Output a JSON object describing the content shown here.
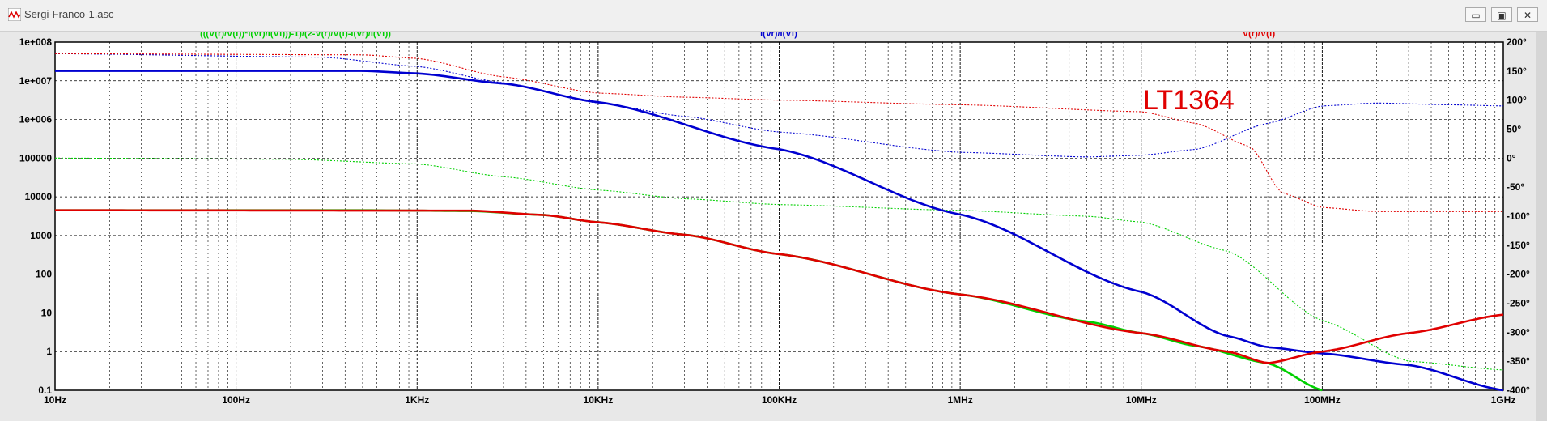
{
  "window": {
    "title": "Sergi-Franco-1.asc",
    "minimize_label": "▭",
    "restore_label": "▣",
    "close_label": "✕"
  },
  "colors": {
    "green": "#00d000",
    "blue": "#0000d0",
    "red": "#e00000",
    "grid": "#000000",
    "background": "#ffffff"
  },
  "chart_data": {
    "type": "line",
    "annotation": "LT1364",
    "x_scale": "log",
    "x_range_hz": [
      10,
      1000000000
    ],
    "x_ticks": [
      {
        "v": 10,
        "label": "10Hz"
      },
      {
        "v": 100,
        "label": "100Hz"
      },
      {
        "v": 1000,
        "label": "1KHz"
      },
      {
        "v": 10000,
        "label": "10KHz"
      },
      {
        "v": 100000,
        "label": "100KHz"
      },
      {
        "v": 1000000,
        "label": "1MHz"
      },
      {
        "v": 10000000,
        "label": "10MHz"
      },
      {
        "v": 100000000,
        "label": "100MHz"
      },
      {
        "v": 1000000000,
        "label": "1GHz"
      }
    ],
    "y_left_scale": "log",
    "y_left_range": [
      0.1,
      100000000
    ],
    "y_left_ticks": [
      {
        "v": 100000000,
        "label": "1e+008"
      },
      {
        "v": 10000000,
        "label": "1e+007"
      },
      {
        "v": 1000000,
        "label": "1e+006"
      },
      {
        "v": 100000,
        "label": "100000"
      },
      {
        "v": 10000,
        "label": "10000"
      },
      {
        "v": 1000,
        "label": "1000"
      },
      {
        "v": 100,
        "label": "100"
      },
      {
        "v": 10,
        "label": "10"
      },
      {
        "v": 1,
        "label": "1"
      },
      {
        "v": 0.1,
        "label": "0.1"
      }
    ],
    "y_right_range_deg": [
      -400,
      200
    ],
    "y_right_ticks": [
      {
        "v": 200,
        "label": "200°"
      },
      {
        "v": 150,
        "label": "150°"
      },
      {
        "v": 100,
        "label": "100°"
      },
      {
        "v": 50,
        "label": "50°"
      },
      {
        "v": 0,
        "label": "0°"
      },
      {
        "v": -50,
        "label": "-50°"
      },
      {
        "v": -100,
        "label": "-100°"
      },
      {
        "v": -150,
        "label": "-150°"
      },
      {
        "v": -200,
        "label": "-200°"
      },
      {
        "v": -250,
        "label": "-250°"
      },
      {
        "v": -300,
        "label": "-300°"
      },
      {
        "v": -350,
        "label": "-350°"
      },
      {
        "v": -400,
        "label": "-400°"
      }
    ],
    "grid": true,
    "series": [
      {
        "name": "(((V(r)/V(f))*I(Vr)/I(Vf)))-1)/(2-V(r)/V(f)-I(Vr)/I(Vf))",
        "color": "green",
        "magnitude": [
          [
            10,
            4500
          ],
          [
            500,
            4500
          ],
          [
            1000,
            4400
          ],
          [
            2000,
            4300
          ],
          [
            5000,
            3400
          ],
          [
            10000,
            2200
          ],
          [
            30000,
            1050
          ],
          [
            100000,
            330
          ],
          [
            1000000,
            30
          ],
          [
            5000000,
            6
          ],
          [
            10000000,
            3
          ],
          [
            20000000,
            1.4
          ],
          [
            50000000,
            0.5
          ],
          [
            100000000,
            0.1
          ]
        ],
        "phase_deg": [
          [
            10,
            0
          ],
          [
            200,
            -2
          ],
          [
            1000,
            -10
          ],
          [
            3000,
            -32
          ],
          [
            10000,
            -55
          ],
          [
            30000,
            -70
          ],
          [
            100000,
            -80
          ],
          [
            1000000,
            -90
          ],
          [
            5000000,
            -100
          ],
          [
            10000000,
            -110
          ],
          [
            30000,
            -70
          ],
          [
            30000000,
            -160
          ],
          [
            100000000,
            -280
          ],
          [
            300000000,
            -350
          ],
          [
            1000000000,
            -365
          ]
        ]
      },
      {
        "name": "I(Vr)/I(Vf)",
        "color": "blue",
        "magnitude": [
          [
            10,
            18000000
          ],
          [
            500,
            18000000
          ],
          [
            1000,
            15500000
          ],
          [
            3000,
            8500000
          ],
          [
            10000,
            2800000
          ],
          [
            100000,
            170000
          ],
          [
            1000000,
            3500
          ],
          [
            10000000,
            35
          ],
          [
            30000000,
            2.5
          ],
          [
            50000000,
            1.3
          ],
          [
            100000000,
            0.9
          ],
          [
            300000000,
            0.45
          ],
          [
            1000000000,
            0.1
          ]
        ],
        "phase_deg": [
          [
            10,
            180
          ],
          [
            300,
            174
          ],
          [
            1000,
            158
          ],
          [
            3000,
            130
          ],
          [
            10000,
            95
          ],
          [
            30000,
            72
          ],
          [
            100000,
            45
          ],
          [
            1000000,
            10
          ],
          [
            5000000,
            2
          ],
          [
            10000000,
            5
          ],
          [
            20000000,
            15
          ],
          [
            50000000,
            60
          ],
          [
            100000000,
            90
          ],
          [
            200000000,
            95
          ],
          [
            500000000,
            92
          ],
          [
            1000000000,
            90
          ]
        ]
      },
      {
        "name": "V(r)/V(f)",
        "color": "red",
        "magnitude": [
          [
            10,
            4500
          ],
          [
            2000,
            4400
          ],
          [
            5000,
            3400
          ],
          [
            10000,
            2200
          ],
          [
            30000,
            1050
          ],
          [
            100000,
            330
          ],
          [
            1000000,
            30
          ],
          [
            10000000,
            3
          ],
          [
            30000000,
            1.0
          ],
          [
            50000000,
            0.5
          ],
          [
            100000000,
            1.0
          ],
          [
            300000000,
            3
          ],
          [
            1000000000,
            9
          ]
        ],
        "phase_deg": [
          [
            10,
            180
          ],
          [
            500,
            178
          ],
          [
            1000,
            172
          ],
          [
            3000,
            140
          ],
          [
            10000,
            112
          ],
          [
            30000,
            105
          ],
          [
            100000,
            100
          ],
          [
            1000000,
            92
          ],
          [
            10000000,
            80
          ],
          [
            20000000,
            60
          ],
          [
            40000000,
            20
          ],
          [
            60000000,
            -60
          ],
          [
            100000000,
            -85
          ],
          [
            200000000,
            -92
          ],
          [
            1000000000,
            -92
          ]
        ]
      }
    ]
  }
}
